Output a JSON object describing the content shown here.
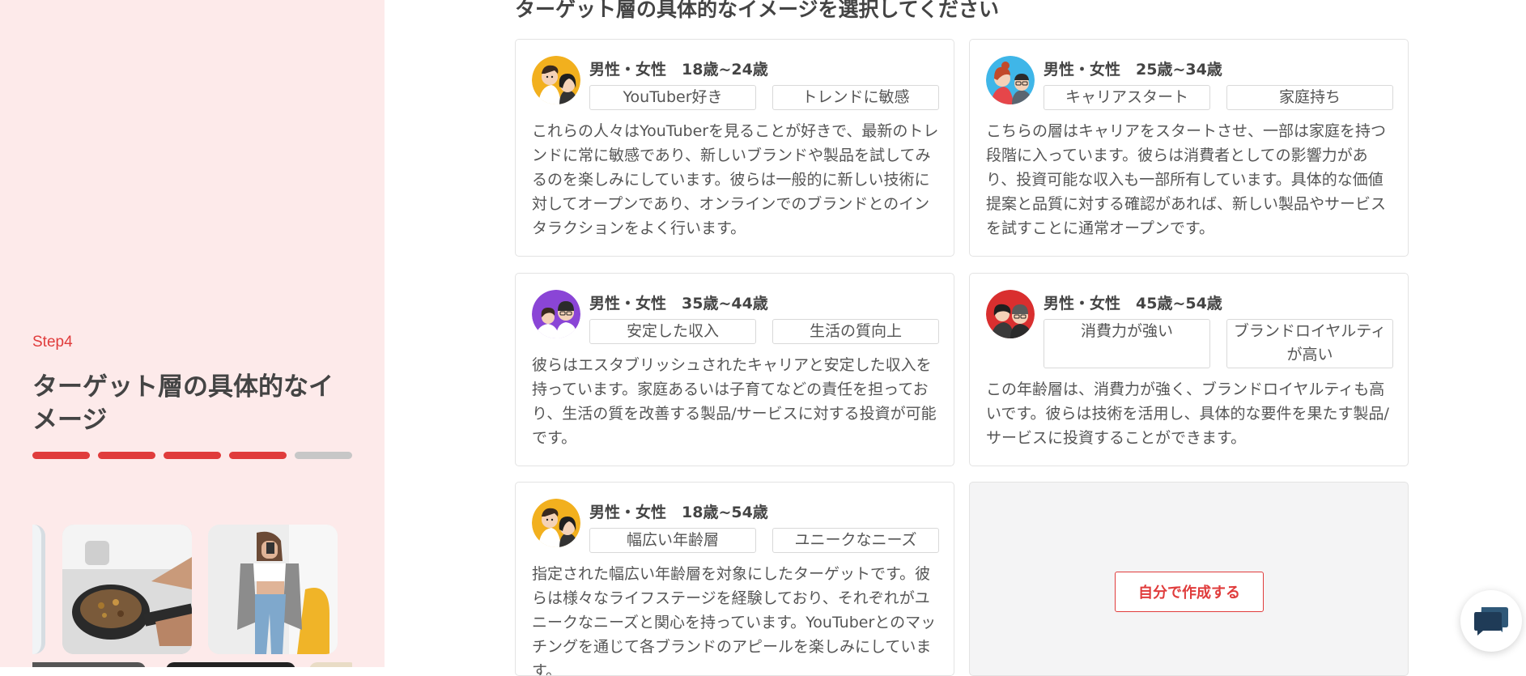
{
  "sidebar": {
    "step": "Step4",
    "title": "ターゲット層の具体的なイメージ",
    "progress": {
      "total": 5,
      "completed": 4
    },
    "gallery": [
      "photo-partial",
      "cooking-photo",
      "fashion-photo",
      "photo-row2-a",
      "photo-row2-b",
      "photo-row2-c"
    ]
  },
  "main": {
    "heading": "ターゲット層の具体的なイメージを選択してください",
    "cards": [
      {
        "header": "男性・女性　18歳~24歳",
        "tags": [
          "YouTuber好き",
          "トレンドに敏感"
        ],
        "description": "これらの人々はYouTuberを見ることが好きで、最新のトレンドに常に敏感であり、新しいブランドや製品を試してみるのを楽しみにしています。彼らは一般的に新しい技術に対してオープンであり、オンラインでのブランドとのインタラクションをよく行います。",
        "avatar_color": "#f2b01e"
      },
      {
        "header": "男性・女性　25歳~34歳",
        "tags": [
          "キャリアスタート",
          "家庭持ち"
        ],
        "description": "こちらの層はキャリアをスタートさせ、一部は家庭を持つ段階に入っています。彼らは消費者としての影響力があり、投資可能な収入も一部所有しています。具体的な価値提案と品質に対する確認があれば、新しい製品やサービスを試すことに通常オープンです。",
        "avatar_color": "#3fb6e8"
      },
      {
        "header": "男性・女性　35歳~44歳",
        "tags": [
          "安定した収入",
          "生活の質向上"
        ],
        "description": "彼らはエスタブリッシュされたキャリアと安定した収入を持っています。家庭あるいは子育てなどの責任を担っており、生活の質を改善する製品/サービスに対する投資が可能です。",
        "avatar_color": "#8a45d6"
      },
      {
        "header": "男性・女性　45歳~54歳",
        "tags": [
          "消費力が強い",
          "ブランドロイヤルティが高い"
        ],
        "description": "この年齢層は、消費力が強く、ブランドロイヤルティも高いです。彼らは技術を活用し、具体的な要件を果たす製品/サービスに投資することができます。",
        "avatar_color": "#d92f2f"
      },
      {
        "header": "男性・女性　18歳~54歳",
        "tags": [
          "幅広い年齢層",
          "ユニークなニーズ"
        ],
        "description": "指定された幅広い年齢層を対象にしたターゲットです。彼らは様々なライフステージを経験しており、それぞれがユニークなニーズと関心を持っています。YouTuberとのマッチングを通じて各ブランドのアピールを楽しみにしています。",
        "avatar_color": "#f2b01e"
      }
    ],
    "create_button": "自分で作成する"
  },
  "chat_widget": {
    "icon": "chat-bubble-icon",
    "color": "#1f3b57"
  }
}
